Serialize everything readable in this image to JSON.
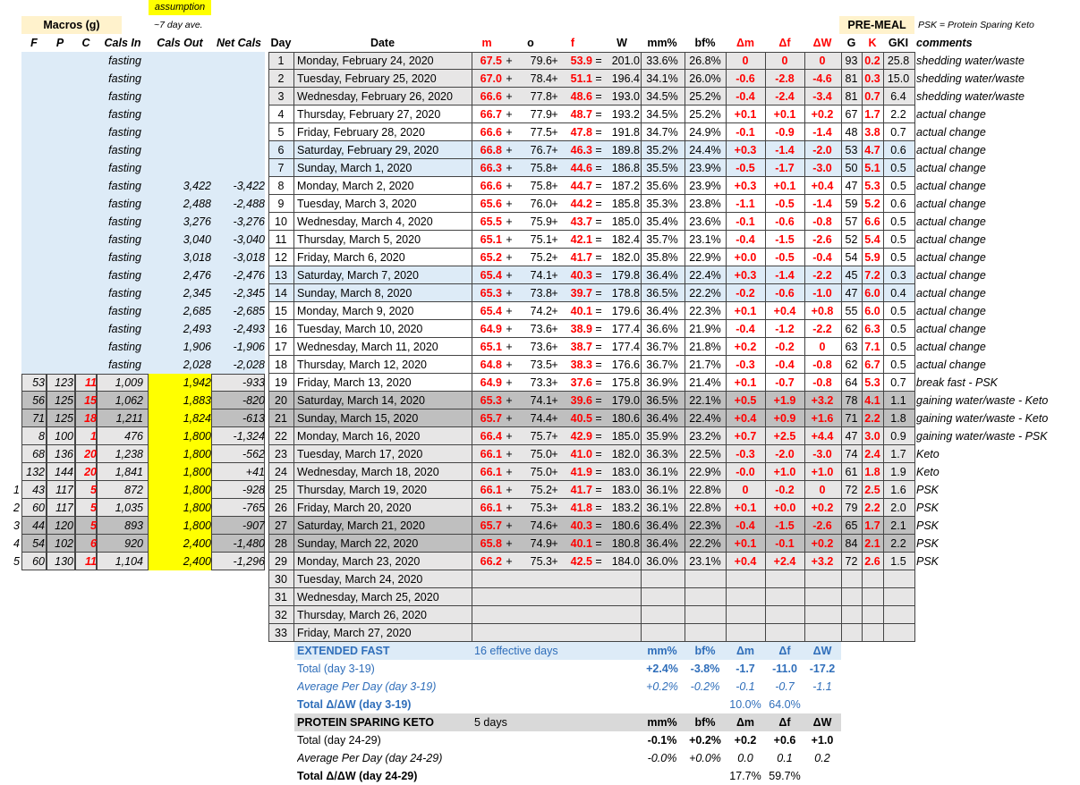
{
  "labels": {
    "assumption": "assumption",
    "macros": "Macros (g)",
    "avg7": "~7 day ave.",
    "premeal": "PRE-MEAL",
    "psk_note": "PSK = Protein Sparing Keto"
  },
  "headers": {
    "F": "F",
    "P": "P",
    "C": "C",
    "cals_in": "Cals In",
    "cals_out": "Cals Out",
    "net_cals": "Net Cals",
    "day": "Day",
    "date": "Date",
    "m": "m",
    "o": "o",
    "f": "f",
    "W": "W",
    "mm": "mm%",
    "bf": "bf%",
    "dm": "Δm",
    "df": "Δf",
    "dW": "ΔW",
    "G": "G",
    "K": "K",
    "GKI": "GKI",
    "comments": "comments"
  },
  "colors": {
    "light_blue": "#ddebf7",
    "yellow": "#ffff00",
    "gray": "#d9d9d9",
    "dark_gray": "#bfbfbf",
    "light_gray": "#e7e6e6",
    "red": "#ff0000",
    "blue_text": "#2f6eba",
    "premeal_bg": "#fff2cc"
  },
  "rows": [
    {
      "idx": "",
      "F": "",
      "P": "",
      "C": "",
      "cin": "fasting",
      "cout": "",
      "net": "",
      "day": "1",
      "date": "Monday, February 24, 2020",
      "m": "67.5",
      "o": "79.6",
      "f": "53.9",
      "W": "201.0",
      "mm": "33.6%",
      "bf": "26.8%",
      "dm": "0",
      "df": "0",
      "dW": "0",
      "G": "93",
      "K": "0.2",
      "GKI": "25.8",
      "comment": "shedding water/waste",
      "style": "gray"
    },
    {
      "idx": "",
      "F": "",
      "P": "",
      "C": "",
      "cin": "fasting",
      "cout": "",
      "net": "",
      "day": "2",
      "date": "Tuesday, February 25, 2020",
      "m": "67.0",
      "o": "78.4",
      "f": "51.1",
      "W": "196.4",
      "mm": "34.1%",
      "bf": "26.0%",
      "dm": "-0.6",
      "df": "-2.8",
      "dW": "-4.6",
      "G": "81",
      "K": "0.3",
      "GKI": "15.0",
      "comment": "shedding water/waste",
      "style": "gray"
    },
    {
      "idx": "",
      "F": "",
      "P": "",
      "C": "",
      "cin": "fasting",
      "cout": "",
      "net": "",
      "day": "3",
      "date": "Wednesday, February 26, 2020",
      "m": "66.6",
      "o": "77.8",
      "f": "48.6",
      "W": "193.0",
      "mm": "34.5%",
      "bf": "25.2%",
      "dm": "-0.4",
      "df": "-2.4",
      "dW": "-3.4",
      "G": "81",
      "K": "0.7",
      "GKI": "6.4",
      "comment": "shedding water/waste",
      "style": "gray"
    },
    {
      "idx": "",
      "F": "",
      "P": "",
      "C": "",
      "cin": "fasting",
      "cout": "",
      "net": "",
      "day": "4",
      "date": "Thursday, February 27, 2020",
      "m": "66.7",
      "o": "77.9",
      "f": "48.7",
      "W": "193.2",
      "mm": "34.5%",
      "bf": "25.2%",
      "dm": "+0.1",
      "df": "+0.1",
      "dW": "+0.2",
      "G": "67",
      "K": "1.7",
      "GKI": "2.2",
      "comment": "actual change",
      "style": "white"
    },
    {
      "idx": "",
      "F": "",
      "P": "",
      "C": "",
      "cin": "fasting",
      "cout": "",
      "net": "",
      "day": "5",
      "date": "Friday, February 28, 2020",
      "m": "66.6",
      "o": "77.5",
      "f": "47.8",
      "W": "191.8",
      "mm": "34.7%",
      "bf": "24.9%",
      "dm": "-0.1",
      "df": "-0.9",
      "dW": "-1.4",
      "G": "48",
      "K": "3.8",
      "GKI": "0.7",
      "comment": "actual change",
      "style": "white"
    },
    {
      "idx": "",
      "F": "",
      "P": "",
      "C": "",
      "cin": "fasting",
      "cout": "",
      "net": "",
      "day": "6",
      "date": "Saturday, February 29, 2020",
      "m": "66.8",
      "o": "76.7",
      "f": "46.3",
      "W": "189.8",
      "mm": "35.2%",
      "bf": "24.4%",
      "dm": "+0.3",
      "df": "-1.4",
      "dW": "-2.0",
      "G": "53",
      "K": "4.7",
      "GKI": "0.6",
      "comment": "actual change",
      "style": "blue"
    },
    {
      "idx": "",
      "F": "",
      "P": "",
      "C": "",
      "cin": "fasting",
      "cout": "",
      "net": "",
      "day": "7",
      "date": "Sunday, March 1, 2020",
      "m": "66.3",
      "o": "75.8",
      "f": "44.6",
      "W": "186.8",
      "mm": "35.5%",
      "bf": "23.9%",
      "dm": "-0.5",
      "df": "-1.7",
      "dW": "-3.0",
      "G": "50",
      "K": "5.1",
      "GKI": "0.5",
      "comment": "actual change",
      "style": "blue"
    },
    {
      "idx": "",
      "F": "",
      "P": "",
      "C": "",
      "cin": "fasting",
      "cout": "3,422",
      "net": "-3,422",
      "day": "8",
      "date": "Monday, March 2, 2020",
      "m": "66.6",
      "o": "75.8",
      "f": "44.7",
      "W": "187.2",
      "mm": "35.6%",
      "bf": "23.9%",
      "dm": "+0.3",
      "df": "+0.1",
      "dW": "+0.4",
      "G": "47",
      "K": "5.3",
      "GKI": "0.5",
      "comment": "actual change",
      "style": "white"
    },
    {
      "idx": "",
      "F": "",
      "P": "",
      "C": "",
      "cin": "fasting",
      "cout": "2,488",
      "net": "-2,488",
      "day": "9",
      "date": "Tuesday, March 3, 2020",
      "m": "65.6",
      "o": "76.0",
      "f": "44.2",
      "W": "185.8",
      "mm": "35.3%",
      "bf": "23.8%",
      "dm": "-1.1",
      "df": "-0.5",
      "dW": "-1.4",
      "G": "59",
      "K": "5.2",
      "GKI": "0.6",
      "comment": "actual change",
      "style": "white"
    },
    {
      "idx": "",
      "F": "",
      "P": "",
      "C": "",
      "cin": "fasting",
      "cout": "3,276",
      "net": "-3,276",
      "day": "10",
      "date": "Wednesday, March 4, 2020",
      "m": "65.5",
      "o": "75.9",
      "f": "43.7",
      "W": "185.0",
      "mm": "35.4%",
      "bf": "23.6%",
      "dm": "-0.1",
      "df": "-0.6",
      "dW": "-0.8",
      "G": "57",
      "K": "6.6",
      "GKI": "0.5",
      "comment": "actual change",
      "style": "white"
    },
    {
      "idx": "",
      "F": "",
      "P": "",
      "C": "",
      "cin": "fasting",
      "cout": "3,040",
      "net": "-3,040",
      "day": "11",
      "date": "Thursday, March 5, 2020",
      "m": "65.1",
      "o": "75.1",
      "f": "42.1",
      "W": "182.4",
      "mm": "35.7%",
      "bf": "23.1%",
      "dm": "-0.4",
      "df": "-1.5",
      "dW": "-2.6",
      "G": "52",
      "K": "5.4",
      "GKI": "0.5",
      "comment": "actual change",
      "style": "white"
    },
    {
      "idx": "",
      "F": "",
      "P": "",
      "C": "",
      "cin": "fasting",
      "cout": "3,018",
      "net": "-3,018",
      "day": "12",
      "date": "Friday, March 6, 2020",
      "m": "65.2",
      "o": "75.2",
      "f": "41.7",
      "W": "182.0",
      "mm": "35.8%",
      "bf": "22.9%",
      "dm": "+0.0",
      "df": "-0.5",
      "dW": "-0.4",
      "G": "54",
      "K": "5.9",
      "GKI": "0.5",
      "comment": "actual change",
      "style": "white"
    },
    {
      "idx": "",
      "F": "",
      "P": "",
      "C": "",
      "cin": "fasting",
      "cout": "2,476",
      "net": "-2,476",
      "day": "13",
      "date": "Saturday, March 7, 2020",
      "m": "65.4",
      "o": "74.1",
      "f": "40.3",
      "W": "179.8",
      "mm": "36.4%",
      "bf": "22.4%",
      "dm": "+0.3",
      "df": "-1.4",
      "dW": "-2.2",
      "G": "45",
      "K": "7.2",
      "GKI": "0.3",
      "comment": "actual change",
      "style": "blue"
    },
    {
      "idx": "",
      "F": "",
      "P": "",
      "C": "",
      "cin": "fasting",
      "cout": "2,345",
      "net": "-2,345",
      "day": "14",
      "date": "Sunday, March 8, 2020",
      "m": "65.3",
      "o": "73.8",
      "f": "39.7",
      "W": "178.8",
      "mm": "36.5%",
      "bf": "22.2%",
      "dm": "-0.2",
      "df": "-0.6",
      "dW": "-1.0",
      "G": "47",
      "K": "6.0",
      "GKI": "0.4",
      "comment": "actual change",
      "style": "blue"
    },
    {
      "idx": "",
      "F": "",
      "P": "",
      "C": "",
      "cin": "fasting",
      "cout": "2,685",
      "net": "-2,685",
      "day": "15",
      "date": "Monday, March 9, 2020",
      "m": "65.4",
      "o": "74.2",
      "f": "40.1",
      "W": "179.6",
      "mm": "36.4%",
      "bf": "22.3%",
      "dm": "+0.1",
      "df": "+0.4",
      "dW": "+0.8",
      "G": "55",
      "K": "6.0",
      "GKI": "0.5",
      "comment": "actual change",
      "style": "white"
    },
    {
      "idx": "",
      "F": "",
      "P": "",
      "C": "",
      "cin": "fasting",
      "cout": "2,493",
      "net": "-2,493",
      "day": "16",
      "date": "Tuesday, March 10, 2020",
      "m": "64.9",
      "o": "73.6",
      "f": "38.9",
      "W": "177.4",
      "mm": "36.6%",
      "bf": "21.9%",
      "dm": "-0.4",
      "df": "-1.2",
      "dW": "-2.2",
      "G": "62",
      "K": "6.3",
      "GKI": "0.5",
      "comment": "actual change",
      "style": "white"
    },
    {
      "idx": "",
      "F": "",
      "P": "",
      "C": "",
      "cin": "fasting",
      "cout": "1,906",
      "net": "-1,906",
      "day": "17",
      "date": "Wednesday, March 11, 2020",
      "m": "65.1",
      "o": "73.6",
      "f": "38.7",
      "W": "177.4",
      "mm": "36.7%",
      "bf": "21.8%",
      "dm": "+0.2",
      "df": "-0.2",
      "dW": "0",
      "G": "63",
      "K": "7.1",
      "GKI": "0.5",
      "comment": "actual change",
      "style": "white"
    },
    {
      "idx": "",
      "F": "",
      "P": "",
      "C": "",
      "cin": "fasting",
      "cout": "2,028",
      "net": "-2,028",
      "day": "18",
      "date": "Thursday, March 12, 2020",
      "m": "64.8",
      "o": "73.5",
      "f": "38.3",
      "W": "176.6",
      "mm": "36.7%",
      "bf": "21.7%",
      "dm": "-0.3",
      "df": "-0.4",
      "dW": "-0.8",
      "G": "62",
      "K": "6.7",
      "GKI": "0.5",
      "comment": "actual change",
      "style": "white"
    },
    {
      "idx": "",
      "F": "53",
      "P": "123",
      "C": "11",
      "cin": "1,009",
      "cout": "1,942",
      "net": "-933",
      "day": "19",
      "date": "Friday, March 13, 2020",
      "m": "64.9",
      "o": "73.3",
      "f": "37.6",
      "W": "175.8",
      "mm": "36.9%",
      "bf": "21.4%",
      "dm": "+0.1",
      "df": "-0.7",
      "dW": "-0.8",
      "G": "64",
      "K": "5.3",
      "GKI": "0.7",
      "comment": "break fast - PSK",
      "style": "white"
    },
    {
      "idx": "",
      "F": "56",
      "P": "125",
      "C": "15",
      "cin": "1,062",
      "cout": "1,883",
      "net": "-820",
      "day": "20",
      "date": "Saturday, March 14, 2020",
      "m": "65.3",
      "o": "74.1",
      "f": "39.6",
      "W": "179.0",
      "mm": "36.5%",
      "bf": "22.1%",
      "dm": "+0.5",
      "df": "+1.9",
      "dW": "+3.2",
      "G": "78",
      "K": "4.1",
      "GKI": "1.1",
      "comment": "gaining water/waste - Keto",
      "style": "dark"
    },
    {
      "idx": "",
      "F": "71",
      "P": "125",
      "C": "18",
      "cin": "1,211",
      "cout": "1,824",
      "net": "-613",
      "day": "21",
      "date": "Sunday, March 15, 2020",
      "m": "65.7",
      "o": "74.4",
      "f": "40.5",
      "W": "180.6",
      "mm": "36.4%",
      "bf": "22.4%",
      "dm": "+0.4",
      "df": "+0.9",
      "dW": "+1.6",
      "G": "71",
      "K": "2.2",
      "GKI": "1.8",
      "comment": "gaining water/waste - Keto",
      "style": "dark"
    },
    {
      "idx": "",
      "F": "8",
      "P": "100",
      "C": "1",
      "cin": "476",
      "cout": "1,800",
      "net": "-1,324",
      "day": "22",
      "date": "Monday, March 16, 2020",
      "m": "66.4",
      "o": "75.7",
      "f": "42.9",
      "W": "185.0",
      "mm": "35.9%",
      "bf": "23.2%",
      "dm": "+0.7",
      "df": "+2.5",
      "dW": "+4.4",
      "G": "47",
      "K": "3.0",
      "GKI": "0.9",
      "comment": "gaining water/waste - PSK",
      "style": "gray"
    },
    {
      "idx": "",
      "F": "68",
      "P": "136",
      "C": "20",
      "cin": "1,238",
      "cout": "1,800",
      "net": "-562",
      "day": "23",
      "date": "Tuesday, March 17, 2020",
      "m": "66.1",
      "o": "75.0",
      "f": "41.0",
      "W": "182.0",
      "mm": "36.3%",
      "bf": "22.5%",
      "dm": "-0.3",
      "df": "-2.0",
      "dW": "-3.0",
      "G": "74",
      "K": "2.4",
      "GKI": "1.7",
      "comment": "Keto",
      "style": "gray"
    },
    {
      "idx": "",
      "F": "132",
      "P": "144",
      "C": "20",
      "cin": "1,841",
      "cout": "1,800",
      "net": "+41",
      "day": "24",
      "date": "Wednesday, March 18, 2020",
      "m": "66.1",
      "o": "75.0",
      "f": "41.9",
      "W": "183.0",
      "mm": "36.1%",
      "bf": "22.9%",
      "dm": "-0.0",
      "df": "+1.0",
      "dW": "+1.0",
      "G": "61",
      "K": "1.8",
      "GKI": "1.9",
      "comment": "Keto",
      "style": "gray"
    },
    {
      "idx": "1",
      "F": "43",
      "P": "117",
      "C": "5",
      "cin": "872",
      "cout": "1,800",
      "net": "-928",
      "day": "25",
      "date": "Thursday, March 19, 2020",
      "m": "66.1",
      "o": "75.2",
      "f": "41.7",
      "W": "183.0",
      "mm": "36.1%",
      "bf": "22.8%",
      "dm": "0",
      "df": "-0.2",
      "dW": "0",
      "G": "72",
      "K": "2.5",
      "GKI": "1.6",
      "comment": "PSK",
      "style": "gray"
    },
    {
      "idx": "2",
      "F": "60",
      "P": "117",
      "C": "5",
      "cin": "1,035",
      "cout": "1,800",
      "net": "-765",
      "day": "26",
      "date": "Friday, March 20, 2020",
      "m": "66.1",
      "o": "75.3",
      "f": "41.8",
      "W": "183.2",
      "mm": "36.1%",
      "bf": "22.8%",
      "dm": "+0.1",
      "df": "+0.0",
      "dW": "+0.2",
      "G": "79",
      "K": "2.2",
      "GKI": "2.0",
      "comment": "PSK",
      "style": "gray"
    },
    {
      "idx": "3",
      "F": "44",
      "P": "120",
      "C": "5",
      "cin": "893",
      "cout": "1,800",
      "net": "-907",
      "day": "27",
      "date": "Saturday, March 21, 2020",
      "m": "65.7",
      "o": "74.6",
      "f": "40.3",
      "W": "180.6",
      "mm": "36.4%",
      "bf": "22.3%",
      "dm": "-0.4",
      "df": "-1.5",
      "dW": "-2.6",
      "G": "65",
      "K": "1.7",
      "GKI": "2.1",
      "comment": "PSK",
      "style": "dark"
    },
    {
      "idx": "4",
      "F": "54",
      "P": "102",
      "C": "6",
      "cin": "920",
      "cout": "2,400",
      "net": "-1,480",
      "day": "28",
      "date": "Sunday, March 22, 2020",
      "m": "65.8",
      "o": "74.9",
      "f": "40.1",
      "W": "180.8",
      "mm": "36.4%",
      "bf": "22.2%",
      "dm": "+0.1",
      "df": "-0.1",
      "dW": "+0.2",
      "G": "84",
      "K": "2.1",
      "GKI": "2.2",
      "comment": "PSK",
      "style": "dark"
    },
    {
      "idx": "5",
      "F": "60",
      "P": "130",
      "C": "11",
      "cin": "1,104",
      "cout": "2,400",
      "net": "-1,296",
      "day": "29",
      "date": "Monday, March 23, 2020",
      "m": "66.2",
      "o": "75.3",
      "f": "42.5",
      "W": "184.0",
      "mm": "36.0%",
      "bf": "23.1%",
      "dm": "+0.4",
      "df": "+2.4",
      "dW": "+3.2",
      "G": "72",
      "K": "2.6",
      "GKI": "1.5",
      "comment": "PSK",
      "style": "gray"
    },
    {
      "idx": "",
      "F": "",
      "P": "",
      "C": "",
      "cin": "",
      "cout": "",
      "net": "",
      "day": "30",
      "date": "Tuesday, March 24, 2020",
      "m": "",
      "o": "",
      "f": "",
      "W": "",
      "mm": "",
      "bf": "",
      "dm": "",
      "df": "",
      "dW": "",
      "G": "",
      "K": "",
      "GKI": "",
      "comment": "",
      "style": "empty"
    },
    {
      "idx": "",
      "F": "",
      "P": "",
      "C": "",
      "cin": "",
      "cout": "",
      "net": "",
      "day": "31",
      "date": "Wednesday, March 25, 2020",
      "m": "",
      "o": "",
      "f": "",
      "W": "",
      "mm": "",
      "bf": "",
      "dm": "",
      "df": "",
      "dW": "",
      "G": "",
      "K": "",
      "GKI": "",
      "comment": "",
      "style": "empty"
    },
    {
      "idx": "",
      "F": "",
      "P": "",
      "C": "",
      "cin": "",
      "cout": "",
      "net": "",
      "day": "32",
      "date": "Thursday, March 26, 2020",
      "m": "",
      "o": "",
      "f": "",
      "W": "",
      "mm": "",
      "bf": "",
      "dm": "",
      "df": "",
      "dW": "",
      "G": "",
      "K": "",
      "GKI": "",
      "comment": "",
      "style": "empty"
    },
    {
      "idx": "",
      "F": "",
      "P": "",
      "C": "",
      "cin": "",
      "cout": "",
      "net": "",
      "day": "33",
      "date": "Friday, March 27, 2020",
      "m": "",
      "o": "",
      "f": "",
      "W": "",
      "mm": "",
      "bf": "",
      "dm": "",
      "df": "",
      "dW": "",
      "G": "",
      "K": "",
      "GKI": "",
      "comment": "",
      "style": "empty"
    }
  ],
  "summary": {
    "extended": {
      "title": "EXTENDED FAST",
      "effective": "16 effective days",
      "h_mm": "mm%",
      "h_bf": "bf%",
      "h_dm": "Δm",
      "h_df": "Δf",
      "h_dW": "ΔW",
      "total_label": "Total (day 3-19)",
      "total": [
        "+2.4%",
        "-3.8%",
        "-1.7",
        "-11.0",
        "-17.2"
      ],
      "avg_label": "Average Per Day (day 3-19)",
      "avg": [
        "+0.2%",
        "-0.2%",
        "-0.1",
        "-0.7",
        "-1.1"
      ],
      "ratio_label": "Total Δ/ΔW (day 3-19)",
      "ratio": [
        "10.0%",
        "64.0%"
      ]
    },
    "psk": {
      "title": "PROTEIN SPARING KETO",
      "days": "5 days",
      "h_mm": "mm%",
      "h_bf": "bf%",
      "h_dm": "Δm",
      "h_df": "Δf",
      "h_dW": "ΔW",
      "total_label": "Total (day 24-29)",
      "total": [
        "-0.1%",
        "+0.2%",
        "+0.2",
        "+0.6",
        "+1.0"
      ],
      "avg_label": "Average Per Day (day 24-29)",
      "avg": [
        "-0.0%",
        "+0.0%",
        "0.0",
        "0.1",
        "0.2"
      ],
      "ratio_label": "Total Δ/ΔW (day 24-29)",
      "ratio": [
        "17.7%",
        "59.7%"
      ]
    }
  }
}
